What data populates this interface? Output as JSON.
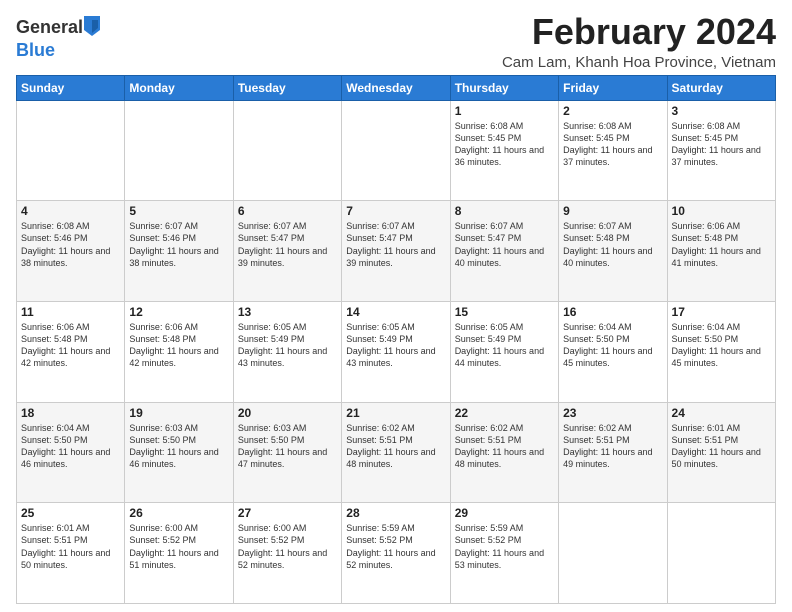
{
  "header": {
    "logo_general": "General",
    "logo_blue": "Blue",
    "main_title": "February 2024",
    "subtitle": "Cam Lam, Khanh Hoa Province, Vietnam"
  },
  "calendar": {
    "days_of_week": [
      "Sunday",
      "Monday",
      "Tuesday",
      "Wednesday",
      "Thursday",
      "Friday",
      "Saturday"
    ],
    "weeks": [
      [
        {
          "day": "",
          "info": ""
        },
        {
          "day": "",
          "info": ""
        },
        {
          "day": "",
          "info": ""
        },
        {
          "day": "",
          "info": ""
        },
        {
          "day": "1",
          "info": "Sunrise: 6:08 AM\nSunset: 5:45 PM\nDaylight: 11 hours\nand 36 minutes."
        },
        {
          "day": "2",
          "info": "Sunrise: 6:08 AM\nSunset: 5:45 PM\nDaylight: 11 hours\nand 37 minutes."
        },
        {
          "day": "3",
          "info": "Sunrise: 6:08 AM\nSunset: 5:45 PM\nDaylight: 11 hours\nand 37 minutes."
        }
      ],
      [
        {
          "day": "4",
          "info": "Sunrise: 6:08 AM\nSunset: 5:46 PM\nDaylight: 11 hours\nand 38 minutes."
        },
        {
          "day": "5",
          "info": "Sunrise: 6:07 AM\nSunset: 5:46 PM\nDaylight: 11 hours\nand 38 minutes."
        },
        {
          "day": "6",
          "info": "Sunrise: 6:07 AM\nSunset: 5:47 PM\nDaylight: 11 hours\nand 39 minutes."
        },
        {
          "day": "7",
          "info": "Sunrise: 6:07 AM\nSunset: 5:47 PM\nDaylight: 11 hours\nand 39 minutes."
        },
        {
          "day": "8",
          "info": "Sunrise: 6:07 AM\nSunset: 5:47 PM\nDaylight: 11 hours\nand 40 minutes."
        },
        {
          "day": "9",
          "info": "Sunrise: 6:07 AM\nSunset: 5:48 PM\nDaylight: 11 hours\nand 40 minutes."
        },
        {
          "day": "10",
          "info": "Sunrise: 6:06 AM\nSunset: 5:48 PM\nDaylight: 11 hours\nand 41 minutes."
        }
      ],
      [
        {
          "day": "11",
          "info": "Sunrise: 6:06 AM\nSunset: 5:48 PM\nDaylight: 11 hours\nand 42 minutes."
        },
        {
          "day": "12",
          "info": "Sunrise: 6:06 AM\nSunset: 5:48 PM\nDaylight: 11 hours\nand 42 minutes."
        },
        {
          "day": "13",
          "info": "Sunrise: 6:05 AM\nSunset: 5:49 PM\nDaylight: 11 hours\nand 43 minutes."
        },
        {
          "day": "14",
          "info": "Sunrise: 6:05 AM\nSunset: 5:49 PM\nDaylight: 11 hours\nand 43 minutes."
        },
        {
          "day": "15",
          "info": "Sunrise: 6:05 AM\nSunset: 5:49 PM\nDaylight: 11 hours\nand 44 minutes."
        },
        {
          "day": "16",
          "info": "Sunrise: 6:04 AM\nSunset: 5:50 PM\nDaylight: 11 hours\nand 45 minutes."
        },
        {
          "day": "17",
          "info": "Sunrise: 6:04 AM\nSunset: 5:50 PM\nDaylight: 11 hours\nand 45 minutes."
        }
      ],
      [
        {
          "day": "18",
          "info": "Sunrise: 6:04 AM\nSunset: 5:50 PM\nDaylight: 11 hours\nand 46 minutes."
        },
        {
          "day": "19",
          "info": "Sunrise: 6:03 AM\nSunset: 5:50 PM\nDaylight: 11 hours\nand 46 minutes."
        },
        {
          "day": "20",
          "info": "Sunrise: 6:03 AM\nSunset: 5:50 PM\nDaylight: 11 hours\nand 47 minutes."
        },
        {
          "day": "21",
          "info": "Sunrise: 6:02 AM\nSunset: 5:51 PM\nDaylight: 11 hours\nand 48 minutes."
        },
        {
          "day": "22",
          "info": "Sunrise: 6:02 AM\nSunset: 5:51 PM\nDaylight: 11 hours\nand 48 minutes."
        },
        {
          "day": "23",
          "info": "Sunrise: 6:02 AM\nSunset: 5:51 PM\nDaylight: 11 hours\nand 49 minutes."
        },
        {
          "day": "24",
          "info": "Sunrise: 6:01 AM\nSunset: 5:51 PM\nDaylight: 11 hours\nand 50 minutes."
        }
      ],
      [
        {
          "day": "25",
          "info": "Sunrise: 6:01 AM\nSunset: 5:51 PM\nDaylight: 11 hours\nand 50 minutes."
        },
        {
          "day": "26",
          "info": "Sunrise: 6:00 AM\nSunset: 5:52 PM\nDaylight: 11 hours\nand 51 minutes."
        },
        {
          "day": "27",
          "info": "Sunrise: 6:00 AM\nSunset: 5:52 PM\nDaylight: 11 hours\nand 52 minutes."
        },
        {
          "day": "28",
          "info": "Sunrise: 5:59 AM\nSunset: 5:52 PM\nDaylight: 11 hours\nand 52 minutes."
        },
        {
          "day": "29",
          "info": "Sunrise: 5:59 AM\nSunset: 5:52 PM\nDaylight: 11 hours\nand 53 minutes."
        },
        {
          "day": "",
          "info": ""
        },
        {
          "day": "",
          "info": ""
        }
      ]
    ]
  }
}
